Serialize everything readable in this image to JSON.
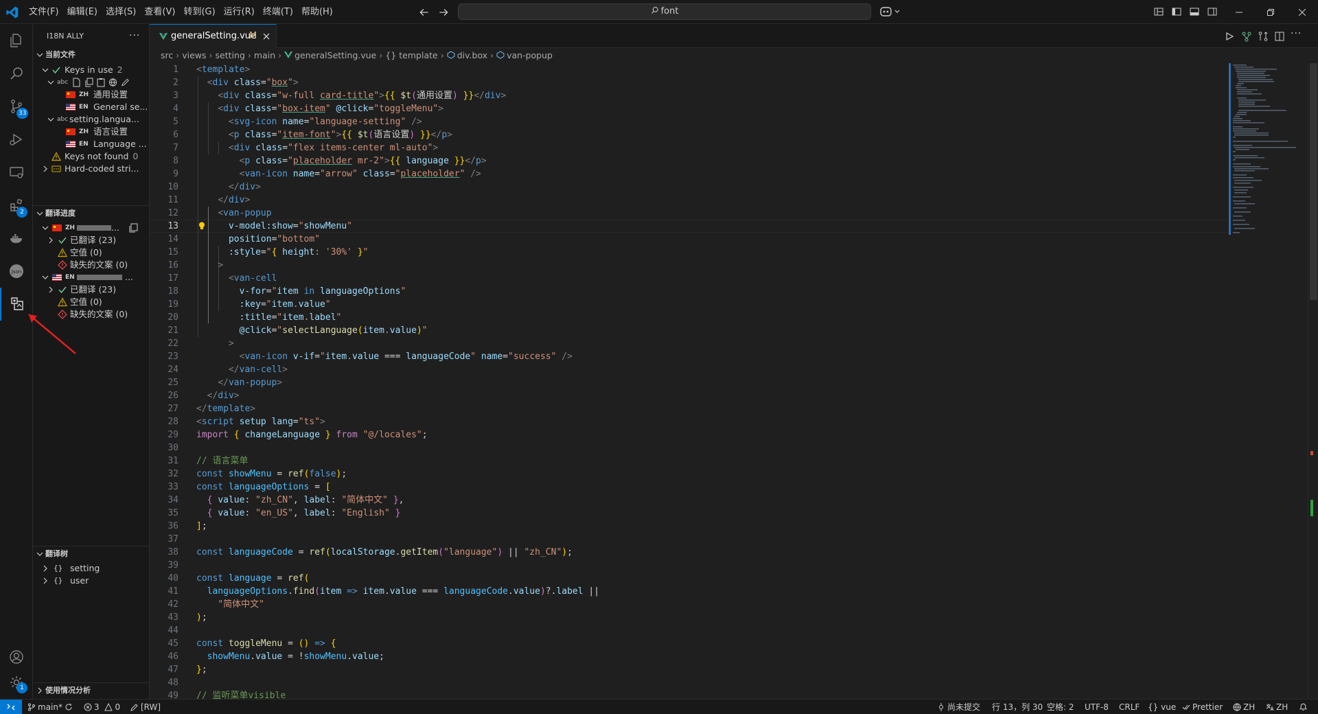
{
  "menu": [
    "文件(F)",
    "编辑(E)",
    "选择(S)",
    "查看(V)",
    "转到(G)",
    "运行(R)",
    "终端(T)",
    "帮助(H)"
  ],
  "search": {
    "text": "font"
  },
  "activity": {
    "scm_badge": "33",
    "ext_badge": "2",
    "settings_badge": "1"
  },
  "sidebar": {
    "title": "I18N ALLY",
    "more": "···",
    "current_file": {
      "header": "当前文件",
      "keys_in_use_label": "Keys in use",
      "keys_in_use_count": "2",
      "key1": {
        "zh_code": "ZH",
        "zh_text": "通用设置",
        "en_code": "EN",
        "en_text": "General se..."
      },
      "key2": {
        "name": "setting.langua...",
        "zh_code": "ZH",
        "zh_text": "语言设置",
        "en_code": "EN",
        "en_text": "Language ..."
      },
      "keys_not_found_label": "Keys not found",
      "keys_not_found_count": "0",
      "hardcoded_label": "Hard-coded stri..."
    },
    "progress": {
      "header": "翻译进度",
      "zh_code": "ZH",
      "en_code": "EN",
      "zh_items": [
        "已翻译 (23)",
        "空值 (0)",
        "缺失的文案 (0)"
      ],
      "en_items": [
        "已翻译 (23)",
        "空值 (0)",
        "缺失的文案 (0)"
      ]
    },
    "tree": {
      "header": "翻译树",
      "items": [
        "setting",
        "user"
      ]
    },
    "usage": {
      "header": "使用情况分析"
    }
  },
  "tab": {
    "name": "generalSetting.vue",
    "modified": "M"
  },
  "breadcrumb": [
    "src",
    "views",
    "setting",
    "main",
    "generalSetting.vue",
    "{} template",
    "div.box",
    "van-popup"
  ],
  "editor": {
    "current_line": 13,
    "line_numbers": [
      "1",
      "2",
      "3",
      "4",
      "5",
      "6",
      "7",
      "8",
      "9",
      "10",
      "11",
      "12",
      "13",
      "14",
      "15",
      "16",
      "17",
      "18",
      "19",
      "20",
      "21",
      "22",
      "23",
      "24",
      "25",
      "26",
      "27",
      "28",
      "29",
      "30",
      "31",
      "32",
      "33",
      "34",
      "35",
      "36",
      "37",
      "38",
      "39",
      "40",
      "41",
      "42",
      "43",
      "44",
      "45",
      "46",
      "47",
      "48",
      "49"
    ]
  },
  "status": {
    "branch": "main*",
    "errors": "3",
    "warnings": "0",
    "rw": "[RW]",
    "uncommitted": "尚未提交",
    "position": "行 13，列 30",
    "spaces": "空格: 2",
    "encoding": "UTF-8",
    "eol": "CRLF",
    "lang": "vue",
    "prettier": "Prettier",
    "locale1": "ZH",
    "locale2": "ZH"
  },
  "colors": {
    "accent": "#0078d4",
    "bg": "#1f1f1f",
    "sidebar_bg": "#181818"
  }
}
